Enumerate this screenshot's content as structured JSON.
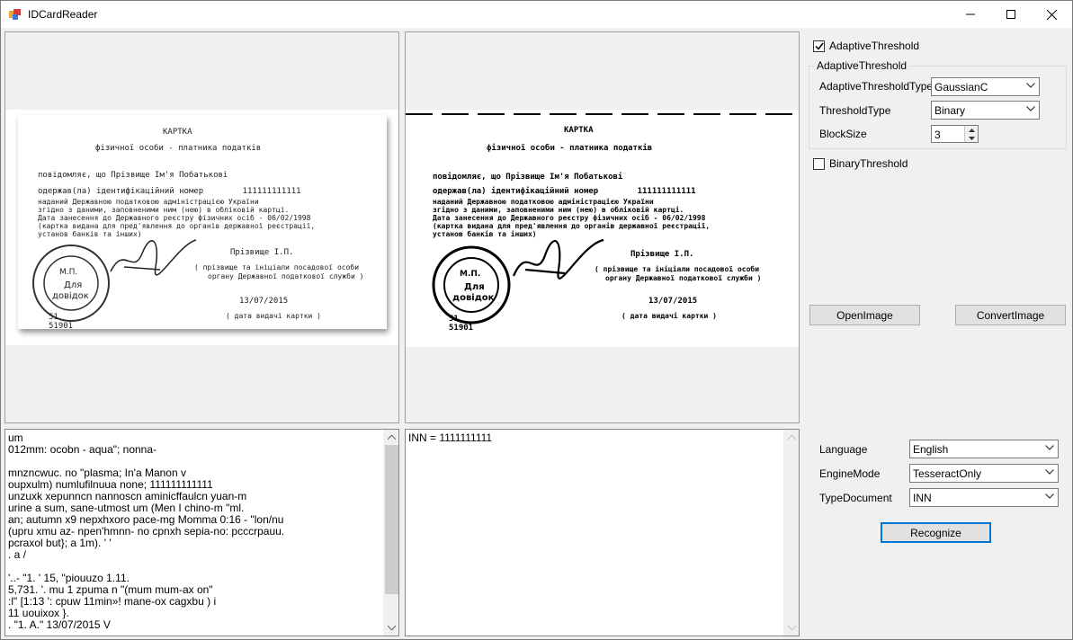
{
  "window": {
    "title": "IDCardReader",
    "controls": {
      "minimize": "minimize-icon",
      "maximize": "maximize-icon",
      "close": "close-icon"
    }
  },
  "card": {
    "header": "КАРТКА",
    "subheader": "фізичної особи - платника податків",
    "line1": "повідомляє, що Прізвище Ім'я Побатькові",
    "line2": "одержав(ла) ідентифікаційний номер        111111111111",
    "line3": "наданий Державною податковою адміністрацією України",
    "line4": "згідно з даними, заповненими ним (нею) в обліковій картці.",
    "line5": "Дата занесення до Державного реєстру фізичних осіб - 06/02/1998",
    "line6": "(картка видана для пред'явлення до органів державної реєстрації,",
    "line7": "установ банків та інших)",
    "signature": "Прізвище І.П.",
    "sig_note1": "( прізвище та ініціали посадової особи",
    "sig_note2": "органу Державної податкової служби )",
    "date": "13/07/2015",
    "date_note": "( дата видачі картки )",
    "stamp_mp": "М.П.",
    "stamp_dlya": "Для",
    "stamp_dovidok": "довідок",
    "code1": "51901",
    "code_partial": "51"
  },
  "ocr_output": {
    "lines": "um\n012mm: ocobn - aqua\"; nonna-\n\nmnzncwuc. no \"plasma; In'a Manon v\noupxulm) numlufilnuua none; 111111111111\nunzuxk xepunncn nannoscn aminicffaulcn yuan-m\nurine a sum, sane-utmost um (Men I chino-m \"ml.\nan; autumn x9 nepxhxoro pace-mg Momma 0:16 - \"lon/nu\n(upru xmu az- npen'hmnn- no cpnxh sepia-no: pcccrpauu.\npcraxol but}; a 1m). ' '\n. a /\n\n'..- \"1. ' 15, \"piouuzo 1.11.\n5,731. '. mu 1 zpuma n \"(mum mum-ax on\"\n:l\" [1:13 ': cpuw 11min»! mane-ox cagxbu ) i\n11 uouixox }.\n. \"1. A.\" 13/07/2015 V"
  },
  "result": {
    "text": "INN = 1111111111"
  },
  "settings": {
    "adaptive_checkbox": {
      "label": "AdaptiveThreshold",
      "checked": true
    },
    "group_title": "AdaptiveThreshold",
    "adaptive_type": {
      "label": "AdaptiveThresholdType",
      "value": "GaussianC"
    },
    "threshold_type": {
      "label": "ThresholdType",
      "value": "Binary"
    },
    "block_size": {
      "label": "BlockSize",
      "value": "3"
    },
    "binary_checkbox": {
      "label": "BinaryThreshold",
      "checked": false
    }
  },
  "buttons": {
    "open_image": "OpenImage",
    "convert_image": "ConvertImage",
    "recognize": "Recognize"
  },
  "recognition": {
    "language": {
      "label": "Language",
      "value": "English"
    },
    "engine_mode": {
      "label": "EngineMode",
      "value": "TesseractOnly"
    },
    "type_document": {
      "label": "TypeDocument",
      "value": "INN"
    }
  }
}
